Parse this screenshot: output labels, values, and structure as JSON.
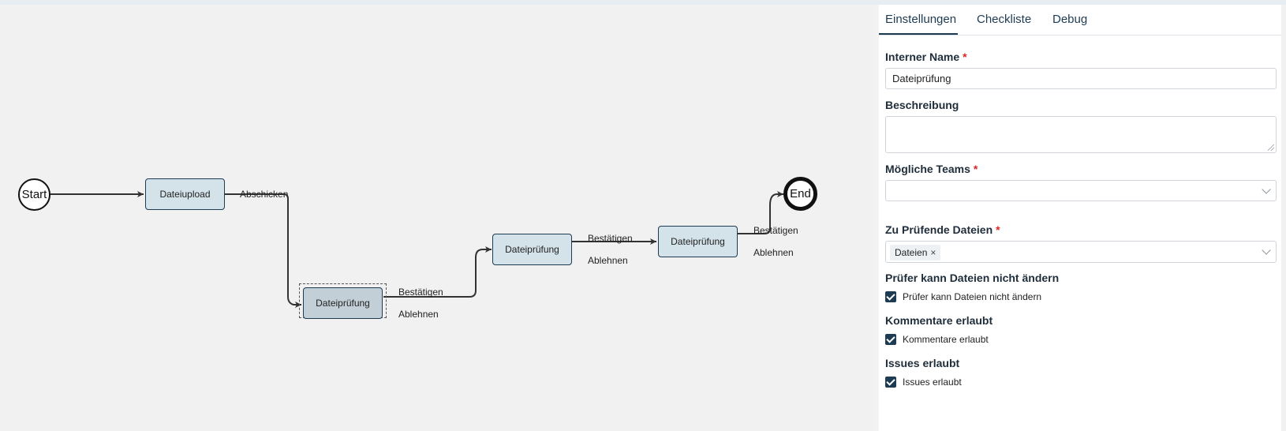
{
  "diagram": {
    "start_label": "Start",
    "end_label": "End",
    "nodes": [
      {
        "label": "Dateiupload"
      },
      {
        "label": "Dateiprüfung"
      },
      {
        "label": "Dateiprüfung"
      },
      {
        "label": "Dateiprüfung"
      }
    ],
    "edges": [
      {
        "label": "Abschicken"
      },
      {
        "label": "Bestätigen"
      },
      {
        "label": "Ablehnen"
      },
      {
        "label": "Bestätigen"
      },
      {
        "label": "Ablehnen"
      },
      {
        "label": "Bestätigen"
      },
      {
        "label": "Ablehnen"
      }
    ]
  },
  "panel": {
    "tabs": [
      {
        "label": "Einstellungen"
      },
      {
        "label": "Checkliste"
      },
      {
        "label": "Debug"
      }
    ],
    "active_tab": "Einstellungen",
    "internal_name": {
      "label": "Interner Name",
      "required": "*",
      "value": "Dateiprüfung"
    },
    "description": {
      "label": "Beschreibung",
      "value": ""
    },
    "teams": {
      "label": "Mögliche Teams",
      "required": "*",
      "value": ""
    },
    "files": {
      "label": "Zu Prüfende Dateien",
      "required": "*",
      "tags": [
        {
          "label": "Dateien",
          "remove": "×"
        }
      ]
    },
    "checks": [
      {
        "heading": "Prüfer kann Dateien nicht ändern",
        "label": "Prüfer kann Dateien nicht ändern",
        "checked": true
      },
      {
        "heading": "Kommentare erlaubt",
        "label": "Kommentare erlaubt",
        "checked": true
      },
      {
        "heading": "Issues erlaubt",
        "label": "Issues erlaubt",
        "checked": true
      }
    ]
  },
  "colors": {
    "accent": "#1d3b53",
    "node_fill": "#d4e2ea",
    "required": "#e02424",
    "canvas": "#f1f1f1"
  }
}
